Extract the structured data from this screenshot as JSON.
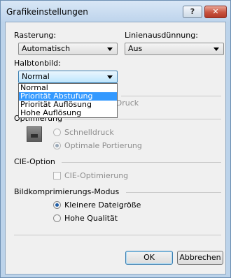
{
  "window": {
    "title": "Grafikeinstellungen",
    "help_label": "?",
    "close_label": "✕"
  },
  "rasterung": {
    "label": "Rasterung:",
    "value": "Automatisch"
  },
  "linienausduennung": {
    "label": "Linienausdünnung:",
    "value": "Aus"
  },
  "halbtonbild": {
    "label": "Halbtonbild:",
    "value": "Normal",
    "options": [
      "Normal",
      "Priorität Abstufung",
      "Priorität Auflösung",
      "Hohe Auflösung"
    ],
    "highlighted_option": "Priorität Abstufung"
  },
  "spiegel": {
    "checkbox_label": "Gespiegelter Druck",
    "checked": false,
    "enabled": false
  },
  "optimierung": {
    "group_label": "Optimierung",
    "option1": "Schnelldruck",
    "option2": "Optimale Portierung",
    "selected": "Optimale Portierung",
    "enabled": false
  },
  "cie": {
    "group_label": "CIE-Option",
    "checkbox_label": "CIE-Optimierung",
    "checked": false,
    "enabled": false
  },
  "bildkompression": {
    "group_label": "Bildkomprimierungs-Modus",
    "option1": "Kleinere Dateigröße",
    "option2": "Hohe Qualität",
    "selected": "Kleinere Dateigröße"
  },
  "buttons": {
    "ok": "OK",
    "cancel": "Abbrechen"
  },
  "colors": {
    "dropdown_highlight": "#3399ff",
    "title_bar": "#bed4ec",
    "close_button": "#c8523e"
  }
}
